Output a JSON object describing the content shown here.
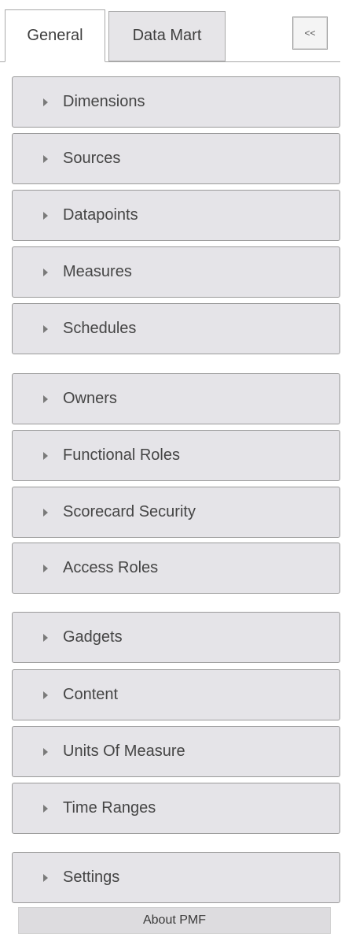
{
  "tabs": [
    {
      "label": "General",
      "active": true
    },
    {
      "label": "Data Mart",
      "active": false
    }
  ],
  "collapse_button": {
    "label": "<<"
  },
  "groups": [
    {
      "items": [
        {
          "label": "Dimensions"
        },
        {
          "label": "Sources"
        },
        {
          "label": "Datapoints"
        },
        {
          "label": "Measures"
        },
        {
          "label": "Schedules"
        }
      ]
    },
    {
      "items": [
        {
          "label": "Owners"
        },
        {
          "label": "Functional Roles"
        },
        {
          "label": "Scorecard Security"
        },
        {
          "label": "Access Roles"
        }
      ]
    },
    {
      "items": [
        {
          "label": "Gadgets"
        },
        {
          "label": "Content"
        },
        {
          "label": "Units Of Measure"
        },
        {
          "label": "Time Ranges"
        }
      ]
    },
    {
      "items": [
        {
          "label": "Settings"
        }
      ]
    }
  ],
  "about": {
    "label": "About PMF"
  },
  "icons": {
    "item_arrow": "caret-right-icon"
  },
  "colors": {
    "item_background": "#e5e4e8",
    "item_border": "#9a9a9a",
    "active_tab": "#ffffff",
    "inactive_tab": "#e6e5e8"
  }
}
